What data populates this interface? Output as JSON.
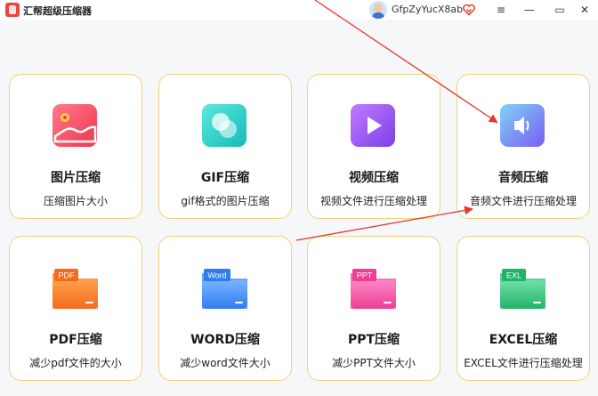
{
  "window": {
    "title": "汇帮超级压缩器",
    "username": "GfpZyYucX8ab",
    "menu_glyph": "≡",
    "min_glyph": "—",
    "max_glyph": "▭",
    "close_glyph": "✕"
  },
  "cards": [
    {
      "name": "图片压缩",
      "desc": "压缩图片大小",
      "icon": "image-icon",
      "color": "#f5445f"
    },
    {
      "name": "GIF压缩",
      "desc": "gif格式的图片压缩",
      "icon": "gif-icon",
      "color": "#22cfc6"
    },
    {
      "name": "视频压缩",
      "desc": "视频文件进行压缩处理",
      "icon": "video-icon",
      "color": "#9b57f0"
    },
    {
      "name": "音频压缩",
      "desc": "音频文件进行压缩处理",
      "icon": "audio-icon",
      "color": "#6b8cf6"
    },
    {
      "name": "PDF压缩",
      "desc": "减少pdf文件的大小",
      "icon": "pdf-folder-icon",
      "badge": "PDF",
      "color": "#f97a2b"
    },
    {
      "name": "WORD压缩",
      "desc": "减少word文件大小",
      "icon": "word-folder-icon",
      "badge": "Word",
      "color": "#3d8af7"
    },
    {
      "name": "PPT压缩",
      "desc": "减少PPT文件大小",
      "icon": "ppt-folder-icon",
      "badge": "PPT",
      "color": "#f25aa8"
    },
    {
      "name": "EXCEL压缩",
      "desc": "EXCEL文件进行压缩处理",
      "icon": "excel-folder-icon",
      "badge": "EXL",
      "color": "#2ec27a"
    }
  ],
  "colors": {
    "card_border": "#f0d27a",
    "annotation_arrow": "#e03a2f"
  }
}
